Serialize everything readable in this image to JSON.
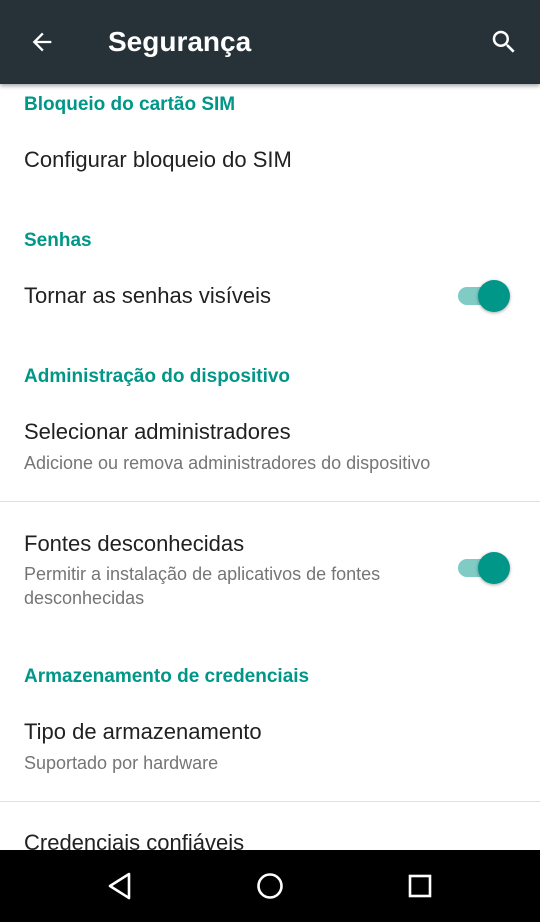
{
  "toolbar": {
    "title": "Segurança",
    "back_icon": "arrow-left-icon",
    "search_icon": "search-icon"
  },
  "sections": {
    "sim": {
      "header": "Bloqueio do cartão SIM",
      "configure": {
        "title": "Configurar bloqueio do SIM"
      }
    },
    "passwords": {
      "header": "Senhas",
      "visible": {
        "title": "Tornar as senhas visíveis",
        "enabled": true
      }
    },
    "device_admin": {
      "header": "Administração do dispositivo",
      "select_admins": {
        "title": "Selecionar administradores",
        "summary": "Adicione ou remova administradores do dispositivo"
      },
      "unknown_sources": {
        "title": "Fontes desconhecidas",
        "summary": "Permitir a instalação de aplicativos de fontes desconhecidas",
        "enabled": true
      }
    },
    "credentials": {
      "header": "Armazenamento de credenciais",
      "storage_type": {
        "title": "Tipo de armazenamento",
        "summary": "Suportado por hardware"
      },
      "trusted": {
        "title": "Credenciais confiáveis"
      }
    }
  },
  "navbar": {
    "back_icon": "triangle-back-icon",
    "home_icon": "circle-home-icon",
    "recents_icon": "square-recents-icon"
  },
  "colors": {
    "toolbar": "#263238",
    "accent": "#009688",
    "accent_light": "#80cbc4",
    "primary_text": "#212121",
    "secondary_text": "#757575",
    "navbar": "#000000"
  }
}
